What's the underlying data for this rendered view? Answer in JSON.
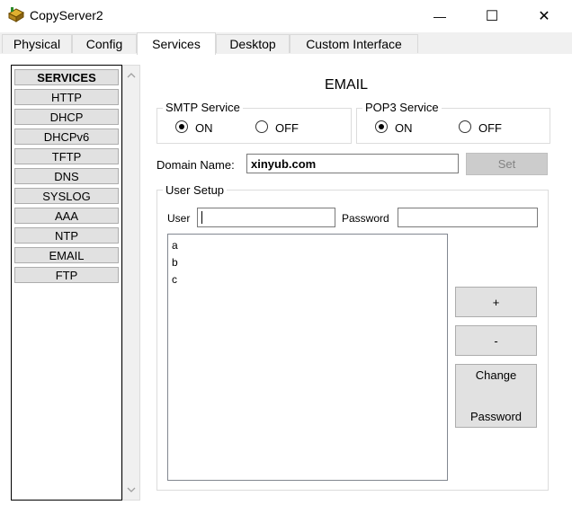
{
  "window": {
    "title": "CopyServer2",
    "minimize_glyph": "—",
    "maximize_glyph": "☐",
    "close_glyph": "✕"
  },
  "tabs": [
    {
      "label": "Physical"
    },
    {
      "label": "Config"
    },
    {
      "label": "Services"
    },
    {
      "label": "Desktop"
    },
    {
      "label": "Custom Interface"
    }
  ],
  "active_tab": "Services",
  "services": {
    "header": "SERVICES",
    "items": [
      "HTTP",
      "DHCP",
      "DHCPv6",
      "TFTP",
      "DNS",
      "SYSLOG",
      "AAA",
      "NTP",
      "EMAIL",
      "FTP"
    ],
    "selected": "EMAIL"
  },
  "email": {
    "heading": "EMAIL",
    "smtp": {
      "title": "SMTP Service",
      "on_label": "ON",
      "off_label": "OFF",
      "value": "ON"
    },
    "pop3": {
      "title": "POP3 Service",
      "on_label": "ON",
      "off_label": "OFF",
      "value": "ON"
    },
    "domain_label": "Domain Name:",
    "domain_value": "xinyub.com",
    "set_label": "Set",
    "user_setup": {
      "title": "User Setup",
      "user_label": "User",
      "user_value": "",
      "password_label": "Password",
      "password_value": "",
      "users": [
        "a",
        "b",
        "c"
      ],
      "add_label": "+",
      "remove_label": "-",
      "change_password_line1": "Change",
      "change_password_line2": "Password"
    }
  },
  "colors": {
    "tab_border": "#d9d9d9",
    "button_face": "#e1e1e1",
    "disabled_button": "#cccccc"
  },
  "icons": {
    "app": "server-box-icon",
    "scroll_up": "chevron-up-icon",
    "scroll_down": "chevron-down-icon"
  }
}
